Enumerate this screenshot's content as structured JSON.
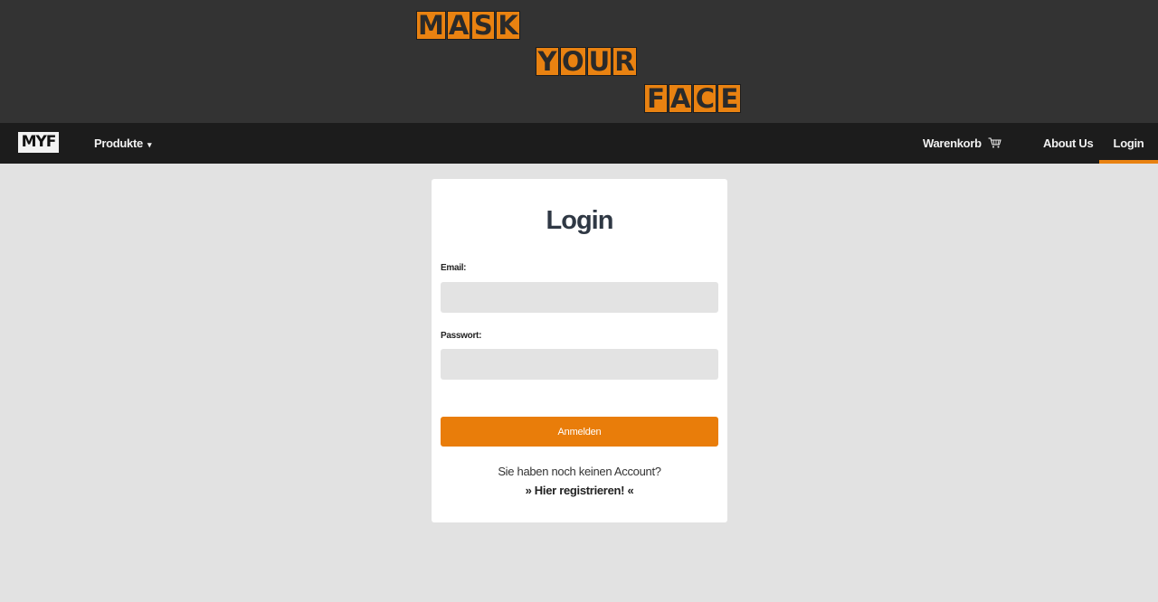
{
  "banner": {
    "words": [
      [
        "M",
        "A",
        "S",
        "K"
      ],
      [
        "Y",
        "O",
        "U",
        "R"
      ],
      [
        "F",
        "A",
        "C",
        "E"
      ]
    ]
  },
  "nav": {
    "logo": "MYF",
    "produkte": "Produkte",
    "caret": "▾",
    "cart": "Warenkorb",
    "about": "About Us",
    "login": "Login"
  },
  "login": {
    "title": "Login",
    "email_label": "Email:",
    "email_value": "",
    "password_label": "Passwort:",
    "password_value": "",
    "submit": "Anmelden",
    "register_question": "Sie haben noch keinen Account?",
    "register_link": "» Hier registrieren! «"
  },
  "colors": {
    "accent": "#e97d0a",
    "banner_bg": "#333333",
    "nav_bg": "#1c1c1c",
    "page_bg": "#e2e2e2"
  },
  "icons": {
    "cart": "shopping-cart-icon"
  }
}
